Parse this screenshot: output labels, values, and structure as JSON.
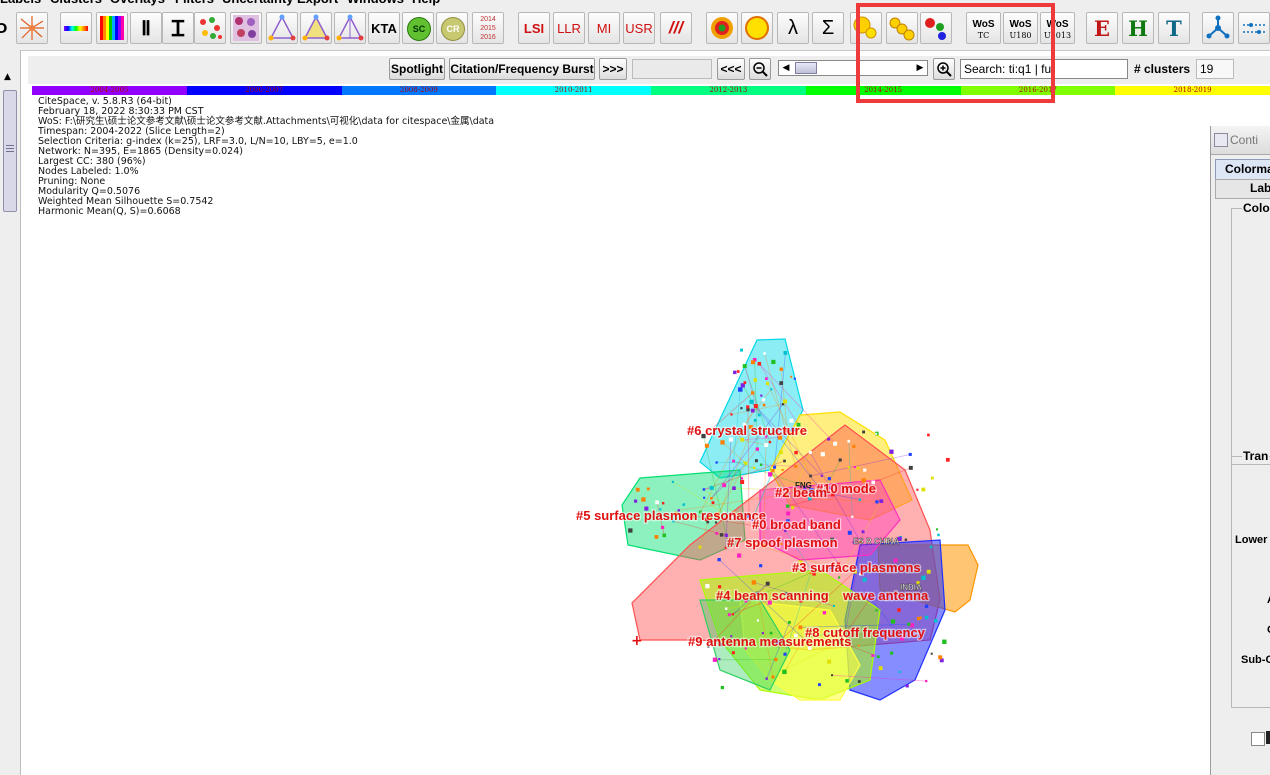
{
  "menubar": {
    "items": [
      "Labels",
      "Clusters",
      "Overlays",
      "Filters",
      "Uncertainty",
      "Export",
      "Windows",
      "Help"
    ]
  },
  "toolbar": {
    "buttons": [
      {
        "icon": "layout-icon"
      },
      {
        "icon": "burst-icon"
      },
      {
        "icon": "colorbar-icon"
      },
      {
        "icon": "heatmap-icon"
      },
      {
        "icon": "h-icon"
      },
      {
        "icon": "i-icon"
      },
      {
        "icon": "scatter-icon"
      },
      {
        "icon": "grid-icon"
      },
      {
        "icon": "triangle-icon"
      },
      {
        "icon": "triangle2-icon"
      },
      {
        "icon": "triangle3-icon"
      },
      {
        "label": "KTA"
      },
      {
        "label": "SC"
      },
      {
        "label": "CR"
      },
      {
        "label": "2014"
      },
      {
        "label": "2015"
      },
      {
        "label": "2016"
      },
      {
        "label": "LSI"
      },
      {
        "label": "LLR"
      },
      {
        "label": "MI"
      },
      {
        "label": "USR"
      },
      {
        "label": "///"
      },
      {
        "icon": "target-icon"
      },
      {
        "icon": "circle-icon"
      },
      {
        "label": "λ"
      },
      {
        "label": "Σ"
      },
      {
        "icon": "circles-icon"
      },
      {
        "icon": "chain-icon"
      },
      {
        "icon": "dots-icon"
      },
      {
        "label": "WoS",
        "sub": "TC"
      },
      {
        "label": "WoS",
        "sub": "U180"
      },
      {
        "label": "WoS",
        "sub": "U2013"
      },
      {
        "label": "E"
      },
      {
        "label": "H"
      },
      {
        "label": "T"
      },
      {
        "icon": "network-icon"
      },
      {
        "icon": "flow-icon"
      }
    ]
  },
  "controls": {
    "spotlight": "Spotlight",
    "burst": "Citation/Frequency Burst",
    "next": ">>>",
    "prev": "<<<",
    "search_value": "Search: ti:q1 | fu",
    "clusters_label": "# clusters",
    "clusters_value": "19"
  },
  "timeline": {
    "slices": [
      {
        "label": "2004-2005",
        "color": "#9000ff"
      },
      {
        "label": "2006-2007",
        "color": "#0000ff"
      },
      {
        "label": "2008-2009",
        "color": "#0077ff"
      },
      {
        "label": "2010-2011",
        "color": "#00ffff"
      },
      {
        "label": "2012-2013",
        "color": "#00ff80"
      },
      {
        "label": "2014-2015",
        "color": "#00ff00"
      },
      {
        "label": "2016-2017",
        "color": "#80ff00"
      },
      {
        "label": "2018-2019",
        "color": "#ffff00"
      }
    ]
  },
  "info": {
    "lines": [
      "CiteSpace, v. 5.8.R3 (64-bit)",
      "February 18, 2022 8:30:33 PM CST",
      "WoS: F:\\研究生\\硕士论文参考文献\\硕士论文参考文献.Attachments\\可视化\\data for citespace\\金属\\data",
      "Timespan: 2004-2022 (Slice Length=2)",
      "Selection Criteria: g-index (k=25), LRF=3.0, L/N=10, LBY=5, e=1.0",
      "Network: N=395, E=1865 (Density=0.024)",
      "Largest CC: 380 (96%)",
      "Nodes Labeled: 1.0%",
      "Pruning: None",
      "Modularity Q=0.5076",
      "Weighted Mean Silhouette S=0.7542",
      "Harmonic Mean(Q, S)=0.6068"
    ]
  },
  "clusters": [
    {
      "label": "#6 crystal structure",
      "color": "#00d8e8"
    },
    {
      "label": "#10 mode",
      "color": "#ffe000"
    },
    {
      "label": "#2 beam",
      "color": "#ff5050"
    },
    {
      "label": "#5 surface plasmon resonance",
      "color": "#00e070"
    },
    {
      "label": "#0 broad band",
      "color": "#ff3030"
    },
    {
      "label": "#7 spoof plasmon",
      "color": "#ff7070"
    },
    {
      "label": "#3 surface plasmons",
      "color": "#ff9500"
    },
    {
      "label": "#4 beam scanning",
      "color": "#a8ff00"
    },
    {
      "label": "wave antenna",
      "color": "#a8ff00"
    },
    {
      "label": "#9 antenna measurements",
      "color": "#ff2020"
    },
    {
      "label": "#8 cutoff frequency",
      "color": "#0000ff"
    }
  ],
  "node_labels": [
    "FNG",
    "ES R CHINA",
    "INDIA"
  ],
  "right_panel": {
    "title": "Conti",
    "tab1": "Colorma",
    "tab2": "Lab",
    "group1": "Colo",
    "group2": "Tran",
    "labels": [
      "Lower",
      "A",
      "C",
      "Sub-C"
    ]
  }
}
